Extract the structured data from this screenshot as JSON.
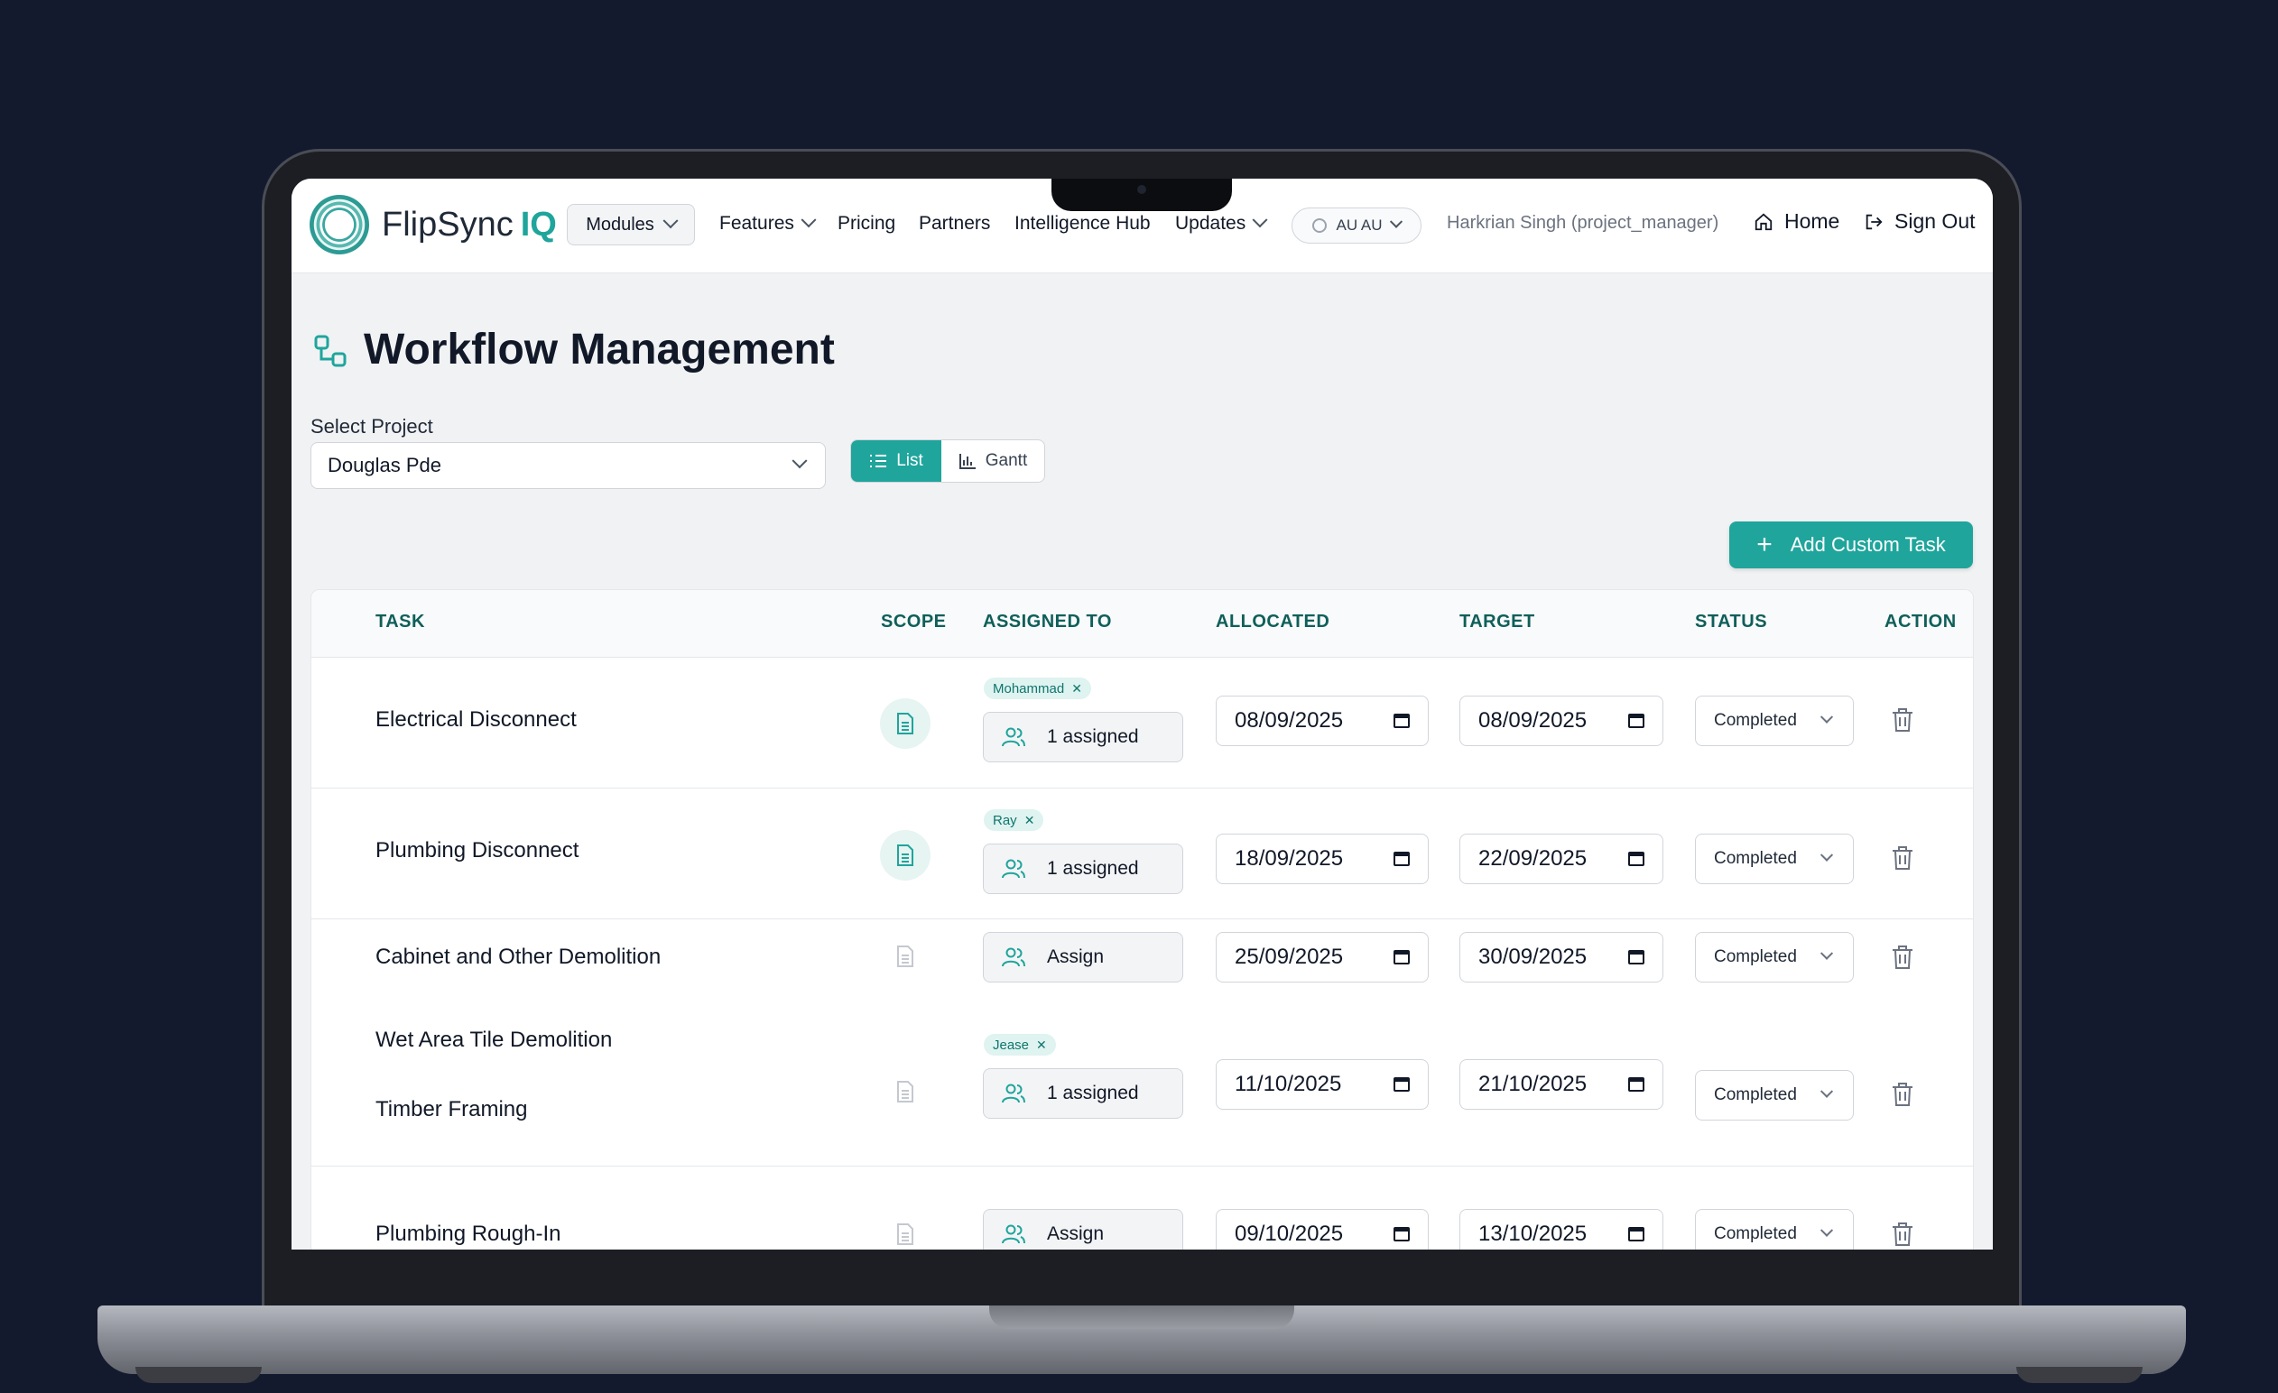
{
  "app": {
    "brand_name": "FlipSync",
    "brand_suffix": "IQ",
    "accent_color": "#1fa59c"
  },
  "navbar": {
    "modules_label": "Modules",
    "links": [
      {
        "label": "Features",
        "has_dropdown": true
      },
      {
        "label": "Pricing",
        "has_dropdown": false
      },
      {
        "label": "Partners",
        "has_dropdown": false
      },
      {
        "label": "Intelligence Hub",
        "has_dropdown": false
      },
      {
        "label": "Updates",
        "has_dropdown": true
      }
    ],
    "locale_label": "AU AU",
    "user_label": "Harkrian Singh (project_manager)",
    "home_label": "Home",
    "signout_label": "Sign Out"
  },
  "page": {
    "title": "Workflow Management",
    "select_project_label": "Select Project",
    "selected_project": "Douglas Pde",
    "view_toggle": {
      "list_label": "List",
      "gantt_label": "Gantt",
      "active": "List"
    },
    "add_task_label": "Add Custom Task"
  },
  "table": {
    "headers": {
      "task": "TASK",
      "scope": "SCOPE",
      "assigned_to": "ASSIGNED TO",
      "allocated": "ALLOCATED",
      "target": "TARGET",
      "status": "STATUS",
      "action": "ACTION"
    },
    "rows": [
      {
        "tasks": [
          "Electrical Disconnect"
        ],
        "scope_icon": "document-icon",
        "scope_active": true,
        "assignee_tag": "Mohammad",
        "assign_label": "1 assigned",
        "allocated": "08/09/2025",
        "target": "08/09/2025",
        "status": "Completed"
      },
      {
        "tasks": [
          "Plumbing Disconnect"
        ],
        "scope_icon": "document-icon",
        "scope_active": true,
        "assignee_tag": "Ray",
        "assign_label": "1 assigned",
        "allocated": "18/09/2025",
        "target": "22/09/2025",
        "status": "Completed"
      },
      {
        "tasks": [
          "Cabinet and Other Demolition"
        ],
        "scope_icon": "document-icon",
        "scope_active": false,
        "assignee_tag": "",
        "assign_label": "Assign",
        "allocated": "25/09/2025",
        "target": "30/09/2025",
        "status": "Completed"
      },
      {
        "tasks": [
          "Wet Area Tile Demolition",
          "Timber Framing"
        ],
        "scope_icon": "document-icon",
        "scope_active": false,
        "assignee_tag": "Jease",
        "assign_label": "1 assigned",
        "allocated": "11/10/2025",
        "target": "21/10/2025",
        "status": "Completed"
      },
      {
        "tasks": [
          "Plumbing Rough-In"
        ],
        "scope_icon": "document-icon",
        "scope_active": false,
        "assignee_tag": "",
        "assign_label": "Assign",
        "allocated": "09/10/2025",
        "target": "13/10/2025",
        "status": "Completed"
      }
    ]
  }
}
